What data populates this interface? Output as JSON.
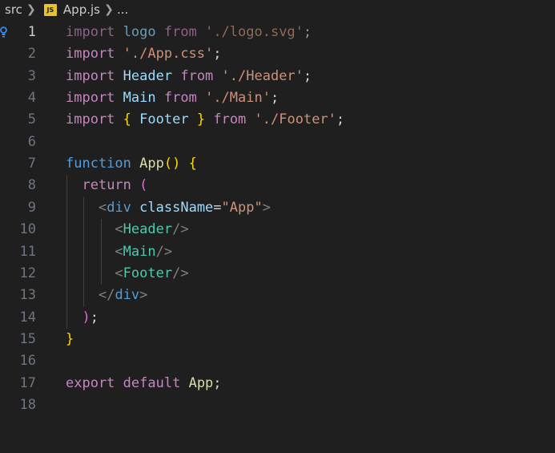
{
  "breadcrumb": {
    "folder": "src",
    "file_icon": "JS",
    "file": "App.js",
    "rest": "..."
  },
  "lines": [
    {
      "n": "1",
      "tokens": [
        {
          "t": "import",
          "c": "kw"
        },
        {
          "t": " "
        },
        {
          "t": "logo",
          "c": "var"
        },
        {
          "t": " "
        },
        {
          "t": "from",
          "c": "kw"
        },
        {
          "t": " "
        },
        {
          "t": "'./logo.svg'",
          "c": "str"
        },
        {
          "t": ";"
        }
      ]
    },
    {
      "n": "2",
      "tokens": [
        {
          "t": "import",
          "c": "kw"
        },
        {
          "t": " "
        },
        {
          "t": "'./App.css'",
          "c": "str"
        },
        {
          "t": ";"
        }
      ]
    },
    {
      "n": "3",
      "tokens": [
        {
          "t": "import",
          "c": "kw"
        },
        {
          "t": " "
        },
        {
          "t": "Header",
          "c": "var"
        },
        {
          "t": " "
        },
        {
          "t": "from",
          "c": "kw"
        },
        {
          "t": " "
        },
        {
          "t": "'./Header'",
          "c": "str"
        },
        {
          "t": ";"
        }
      ]
    },
    {
      "n": "4",
      "tokens": [
        {
          "t": "import",
          "c": "kw"
        },
        {
          "t": " "
        },
        {
          "t": "Main",
          "c": "var"
        },
        {
          "t": " "
        },
        {
          "t": "from",
          "c": "kw"
        },
        {
          "t": " "
        },
        {
          "t": "'./Main'",
          "c": "str"
        },
        {
          "t": ";"
        }
      ]
    },
    {
      "n": "5",
      "tokens": [
        {
          "t": "import",
          "c": "kw"
        },
        {
          "t": " "
        },
        {
          "t": "{",
          "c": "br1"
        },
        {
          "t": " "
        },
        {
          "t": "Footer",
          "c": "var"
        },
        {
          "t": " "
        },
        {
          "t": "}",
          "c": "br1"
        },
        {
          "t": " "
        },
        {
          "t": "from",
          "c": "kw"
        },
        {
          "t": " "
        },
        {
          "t": "'./Footer'",
          "c": "str"
        },
        {
          "t": ";"
        }
      ]
    },
    {
      "n": "6",
      "tokens": []
    },
    {
      "n": "7",
      "tokens": [
        {
          "t": "function",
          "c": "kwb"
        },
        {
          "t": " "
        },
        {
          "t": "App",
          "c": "fn"
        },
        {
          "t": "()",
          "c": "br1"
        },
        {
          "t": " "
        },
        {
          "t": "{",
          "c": "br1"
        }
      ]
    },
    {
      "n": "8",
      "tokens": [
        {
          "t": "  "
        },
        {
          "t": "return",
          "c": "kw"
        },
        {
          "t": " "
        },
        {
          "t": "(",
          "c": "br2"
        }
      ]
    },
    {
      "n": "9",
      "tokens": [
        {
          "t": "    "
        },
        {
          "t": "<",
          "c": "tagbr"
        },
        {
          "t": "div",
          "c": "kwb"
        },
        {
          "t": " "
        },
        {
          "t": "className",
          "c": "var"
        },
        {
          "t": "="
        },
        {
          "t": "\"App\"",
          "c": "str"
        },
        {
          "t": ">",
          "c": "tagbr"
        }
      ]
    },
    {
      "n": "10",
      "tokens": [
        {
          "t": "      "
        },
        {
          "t": "<",
          "c": "tagbr"
        },
        {
          "t": "Header",
          "c": "comp"
        },
        {
          "t": "/>",
          "c": "tagbr"
        }
      ]
    },
    {
      "n": "11",
      "tokens": [
        {
          "t": "      "
        },
        {
          "t": "<",
          "c": "tagbr"
        },
        {
          "t": "Main",
          "c": "comp"
        },
        {
          "t": "/>",
          "c": "tagbr"
        }
      ]
    },
    {
      "n": "12",
      "tokens": [
        {
          "t": "      "
        },
        {
          "t": "<",
          "c": "tagbr"
        },
        {
          "t": "Footer",
          "c": "comp"
        },
        {
          "t": "/>",
          "c": "tagbr"
        }
      ]
    },
    {
      "n": "13",
      "tokens": [
        {
          "t": "    "
        },
        {
          "t": "</",
          "c": "tagbr"
        },
        {
          "t": "div",
          "c": "kwb"
        },
        {
          "t": ">",
          "c": "tagbr"
        }
      ]
    },
    {
      "n": "14",
      "tokens": [
        {
          "t": "  "
        },
        {
          "t": ")",
          "c": "br2"
        },
        {
          "t": ";"
        }
      ]
    },
    {
      "n": "15",
      "tokens": [
        {
          "t": "}",
          "c": "br1"
        }
      ]
    },
    {
      "n": "16",
      "tokens": []
    },
    {
      "n": "17",
      "tokens": [
        {
          "t": "export",
          "c": "kw"
        },
        {
          "t": " "
        },
        {
          "t": "default",
          "c": "kw"
        },
        {
          "t": " "
        },
        {
          "t": "App",
          "c": "fn"
        },
        {
          "t": ";"
        }
      ]
    },
    {
      "n": "18",
      "tokens": []
    }
  ],
  "active_line": "1",
  "dimmed_line": "1",
  "lightbulb_icon": "lightbulb-icon",
  "colors": {
    "background": "#1f1f1f",
    "keyword": "#c586c0",
    "keyword_blue": "#569cd6",
    "variable": "#9cdcfe",
    "string": "#ce9178",
    "function": "#dcdcaa",
    "component": "#4ec9b0",
    "bracket_gold": "#ffd700",
    "bracket_violet": "#da70d6",
    "line_number": "#6e7681"
  }
}
